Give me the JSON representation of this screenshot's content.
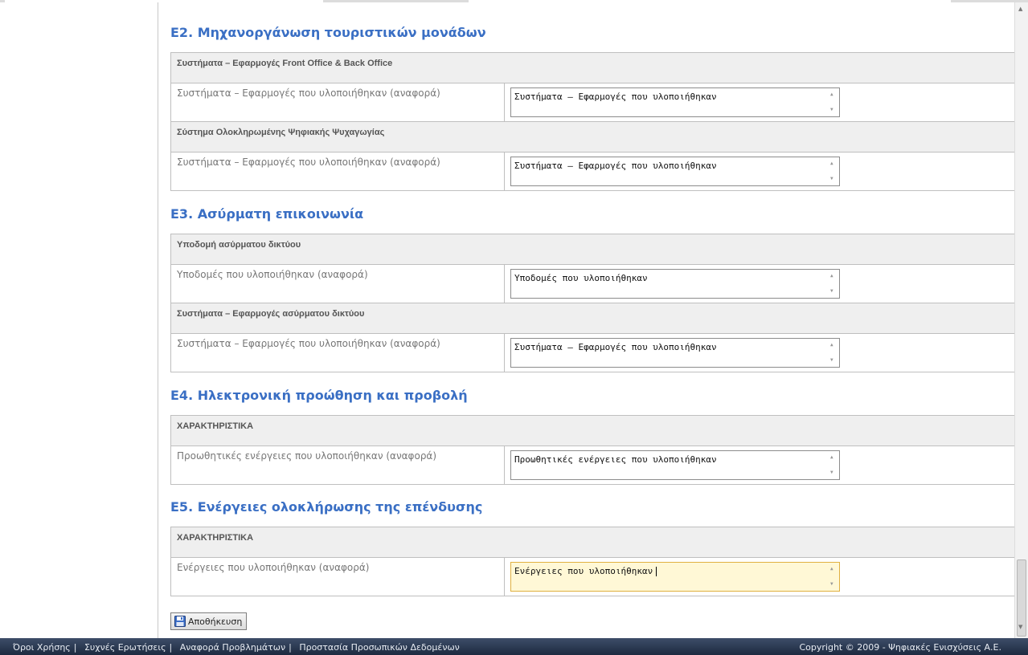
{
  "sections": [
    {
      "heading": "Ε2. Μηχανοργάνωση τουριστικών μονάδων",
      "groups": [
        {
          "title": "Συστήματα – Εφαρμογές Front Office & Back Office",
          "field_label": "Συστήματα – Εφαρμογές που υλοποιήθηκαν (αναφορά)",
          "value": "Συστήματα – Εφαρμογές που υλοποιήθηκαν"
        },
        {
          "title": "Σύστημα Ολοκληρωμένης Ψηφιακής Ψυχαγωγίας",
          "field_label": "Συστήματα – Εφαρμογές που υλοποιήθηκαν (αναφορά)",
          "value": "Συστήματα – Εφαρμογές που υλοποιήθηκαν"
        }
      ]
    },
    {
      "heading": "Ε3. Ασύρματη επικοινωνία",
      "groups": [
        {
          "title": "Υποδομή ασύρματου δικτύου",
          "field_label": "Υποδομές που υλοποιήθηκαν (αναφορά)",
          "value": "Υποδομές που υλοποιήθηκαν"
        },
        {
          "title": "Συστήματα – Εφαρμογές ασύρματου δικτύου",
          "field_label": "Συστήματα – Εφαρμογές που υλοποιήθηκαν (αναφορά)",
          "value": "Συστήματα – Εφαρμογές που υλοποιήθηκαν"
        }
      ]
    },
    {
      "heading": "Ε4. Ηλεκτρονική προώθηση και προβολή",
      "groups": [
        {
          "title": "ΧΑΡΑΚΤΗΡΙΣΤΙΚΑ",
          "field_label": "Προωθητικές ενέργειες που υλοποιήθηκαν (αναφορά)",
          "value": "Προωθητικές ενέργειες που υλοποιήθηκαν"
        }
      ]
    },
    {
      "heading": "Ε5. Ενέργειες ολοκλήρωσης της επένδυσης",
      "groups": [
        {
          "title": "ΧΑΡΑΚΤΗΡΙΣΤΙΚΑ",
          "field_label": "Ενέργειες που υλοποιήθηκαν (αναφορά)",
          "value": "Ενέργειες που υλοποιήθηκαν"
        }
      ]
    }
  ],
  "save_button": {
    "label": "Αποθήκευση",
    "icon": "floppy-disk-icon"
  },
  "footer": {
    "links": [
      "Όροι Χρήσης",
      "Συχνές Ερωτήσεις",
      "Αναφορά Προβλημάτων",
      "Προστασία Προσωπικών Δεδομένων"
    ],
    "separator": "|",
    "copyright": "Copyright © 2009 - Ψηφιακές Ενισχύσεις Α.Ε."
  },
  "colors": {
    "heading": "#3a6fc4",
    "group_header_bg": "#efefef",
    "active_field_bg": "#fff8d6",
    "footer_bg": "#1d2a40"
  }
}
